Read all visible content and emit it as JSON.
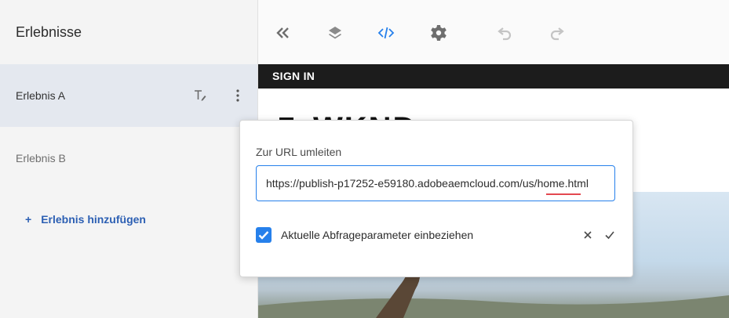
{
  "sidebar": {
    "title": "Erlebnisse",
    "items": [
      {
        "label": "Erlebnis A"
      },
      {
        "label": "Erlebnis B"
      }
    ],
    "add_label": "Erlebnis hinzufügen",
    "add_prefix": "+"
  },
  "toolbar": {
    "icons": [
      "collapse-left-icon",
      "layers-icon",
      "code-icon",
      "settings-icon",
      "undo-icon",
      "redo-icon"
    ]
  },
  "preview": {
    "signin": "SIGN IN",
    "brand": "WKND"
  },
  "redirect_popover": {
    "label": "Zur URL umleiten",
    "url_value": "https://publish-p17252-e59180.adobeaemcloud.com/us/home.html",
    "include_params_label": "Aktuelle Abfrageparameter einbeziehen",
    "include_params_checked": true
  },
  "colors": {
    "accent": "#2680eb",
    "link": "#2c5fb3",
    "selected_bg": "#e4e8ef",
    "error_underline": "#e34850"
  }
}
